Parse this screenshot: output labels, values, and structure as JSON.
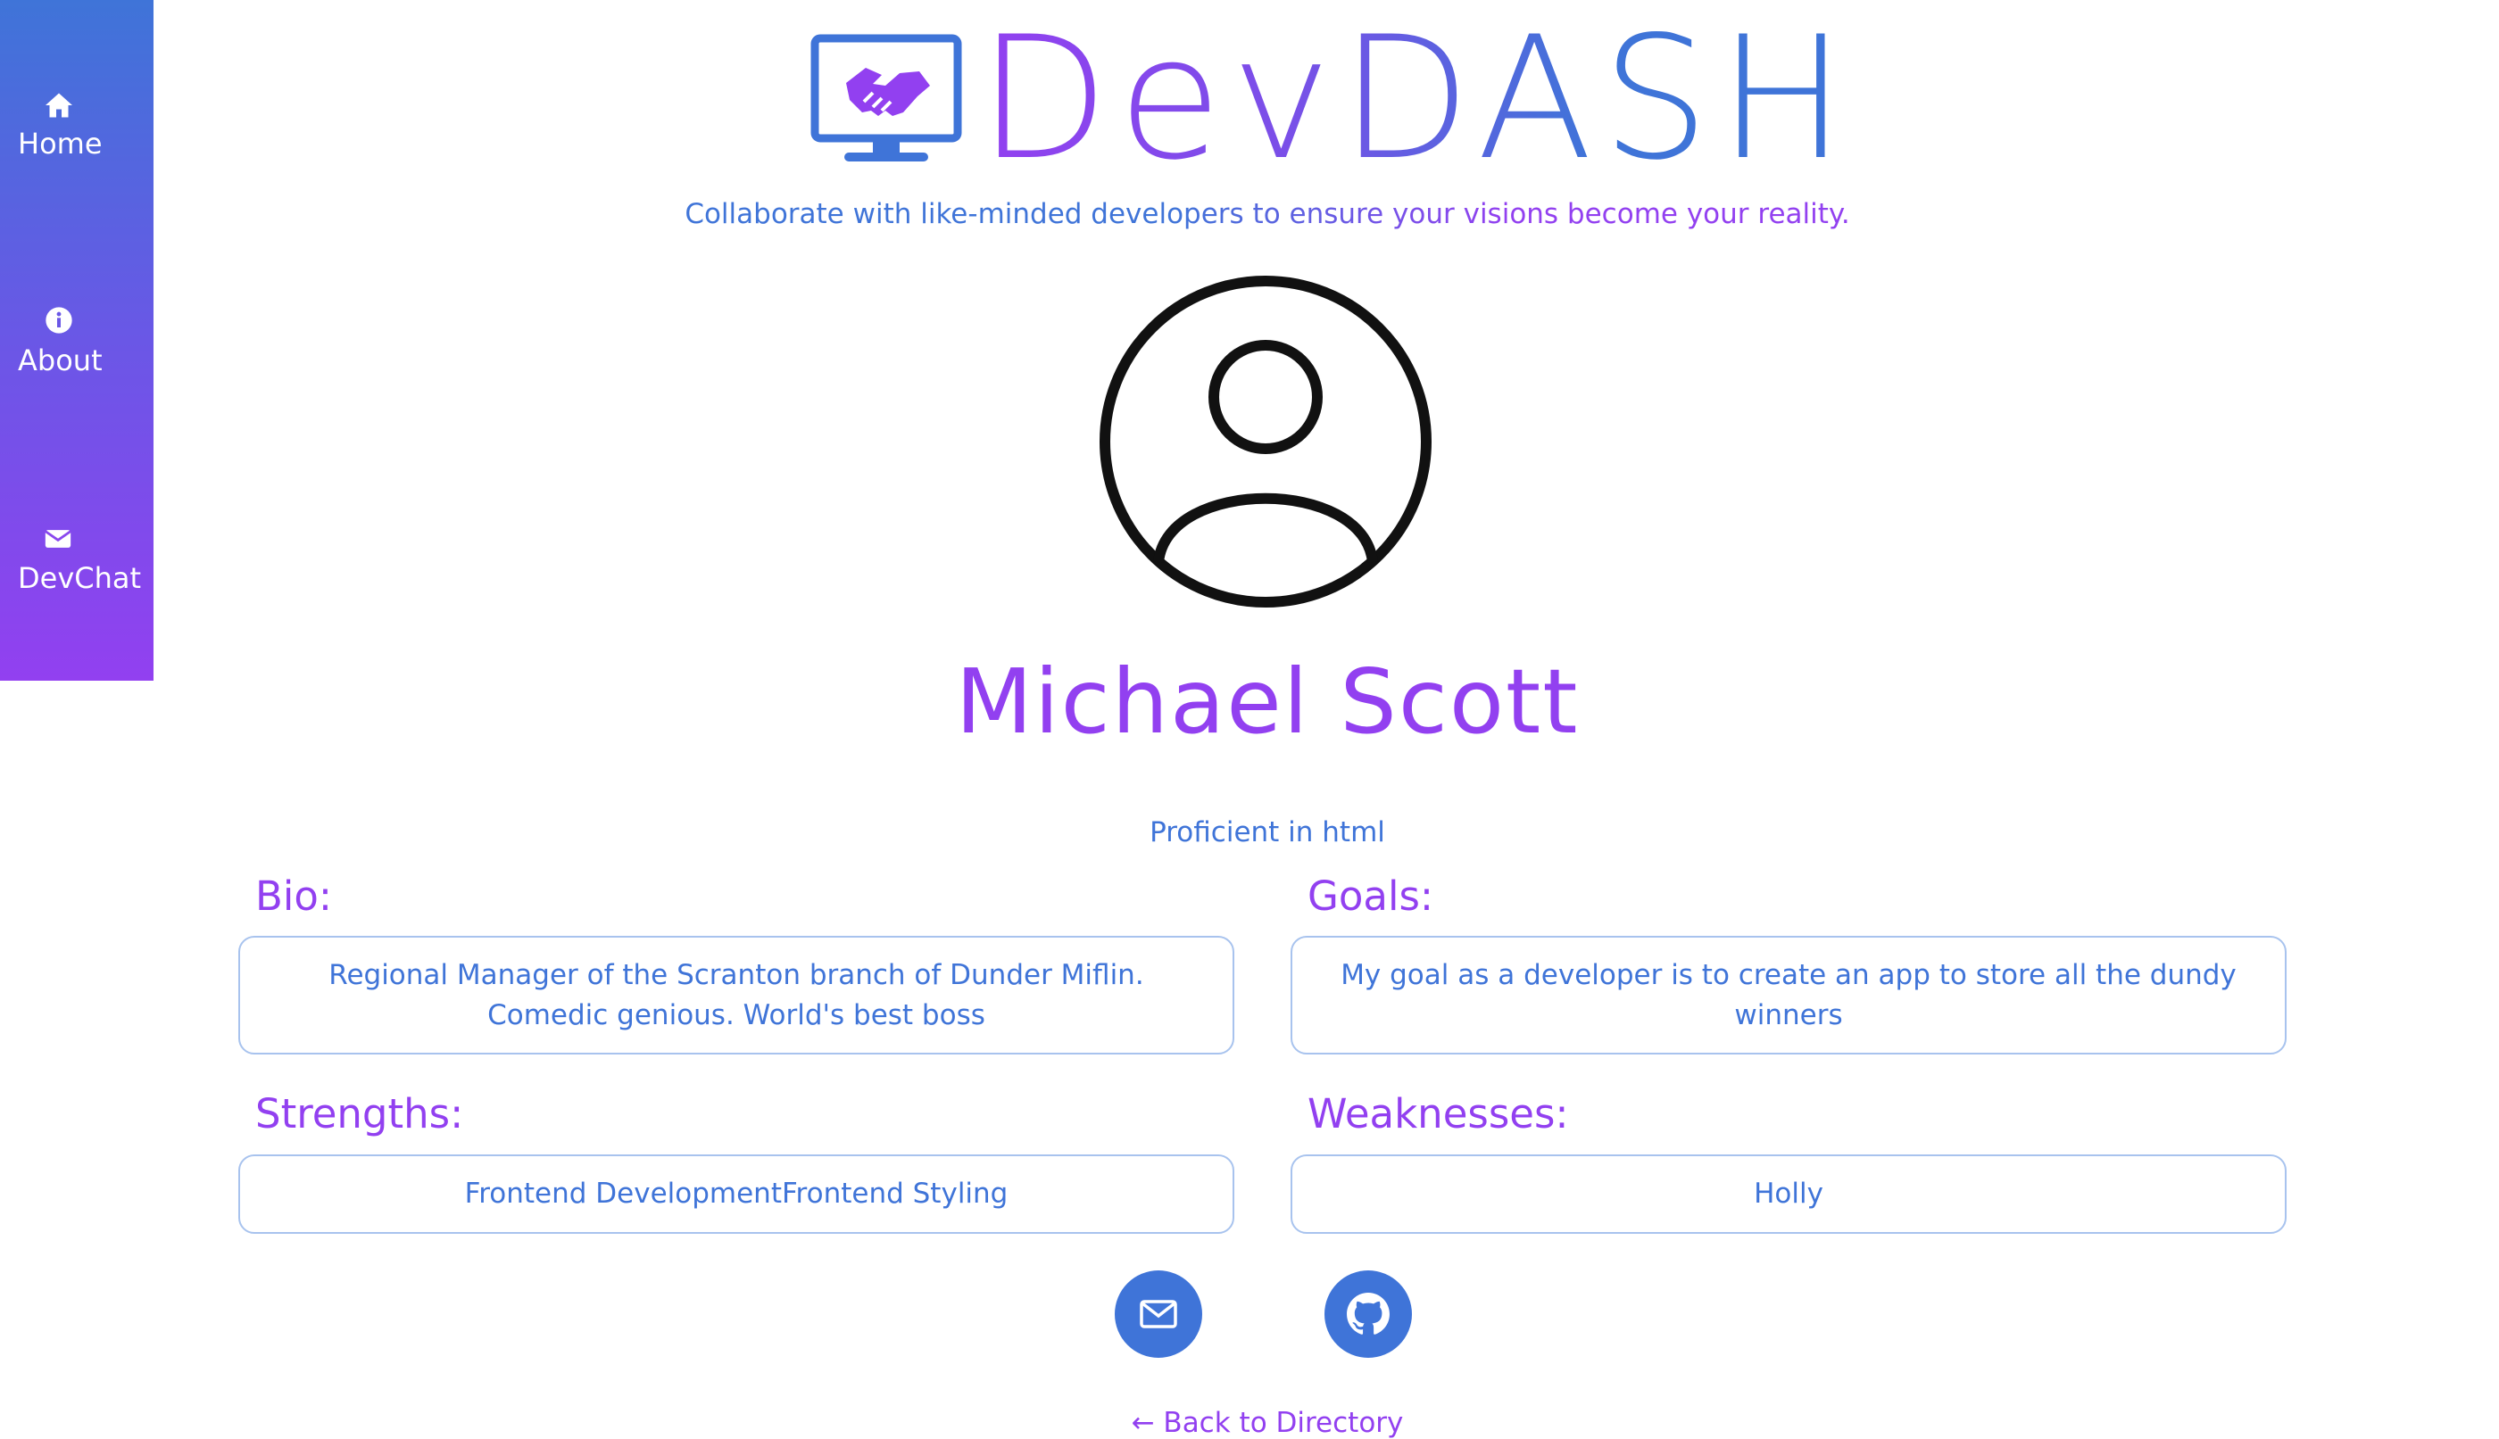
{
  "sidebar": {
    "items": [
      {
        "label": "Home",
        "icon": "home-icon"
      },
      {
        "label": "About",
        "icon": "info-icon"
      },
      {
        "label": "DevChat",
        "icon": "envelope-icon"
      }
    ]
  },
  "header": {
    "logo_text": "DevDASH",
    "tagline": "Collaborate with like-minded developers to ensure your visions become your reality."
  },
  "profile": {
    "name": "Michael Scott",
    "proficiency": "Proficient in html",
    "bio_label": "Bio:",
    "bio": "Regional Manager of the Scranton branch of Dunder Miflin. Comedic genious. World's best boss",
    "goals_label": "Goals:",
    "goals": "My goal as a developer is to create an app to store all the dundy winners",
    "strengths_label": "Strengths:",
    "strengths": "Frontend DevelopmentFrontend Styling",
    "weaknesses_label": "Weaknesses:",
    "weaknesses": "Holly"
  },
  "contact": {
    "email_icon": "mail-icon",
    "github_icon": "github-icon"
  },
  "back_link": "← Back to Directory",
  "colors": {
    "blue": "#3f74d8",
    "purple": "#9240f0",
    "border": "#a8c3ee"
  }
}
